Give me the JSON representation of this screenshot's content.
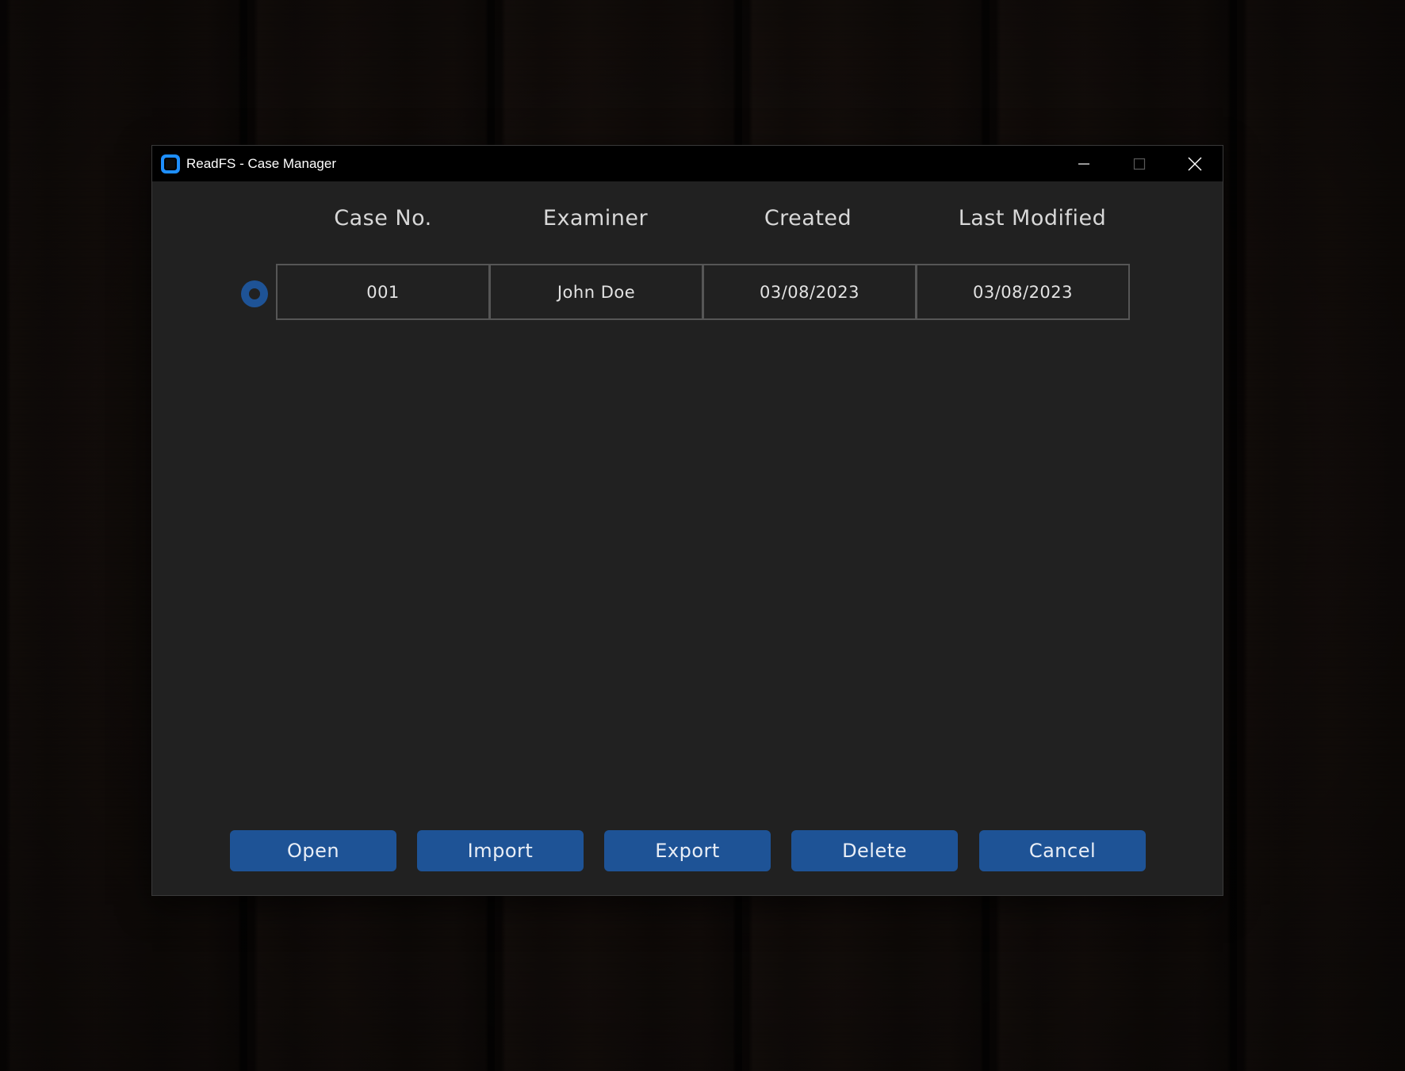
{
  "window": {
    "title": "ReadFS - Case Manager",
    "icon": "app-icon",
    "controls": [
      "minimize-icon",
      "maximize-icon",
      "close-icon"
    ]
  },
  "table": {
    "headers": [
      "Case No.",
      "Examiner",
      "Created",
      "Last Modified"
    ],
    "rows": [
      {
        "selected": true,
        "case_no": "001",
        "examiner": "John Doe",
        "created": "03/08/2023",
        "last_modified": "03/08/2023"
      }
    ]
  },
  "buttons": {
    "open": "Open",
    "import": "Import",
    "export": "Export",
    "delete": "Delete",
    "cancel": "Cancel"
  },
  "colors": {
    "accent": "#1e5396",
    "app_icon": "#1e8fff",
    "window_bg": "#212121",
    "titlebar_bg": "#000000"
  }
}
